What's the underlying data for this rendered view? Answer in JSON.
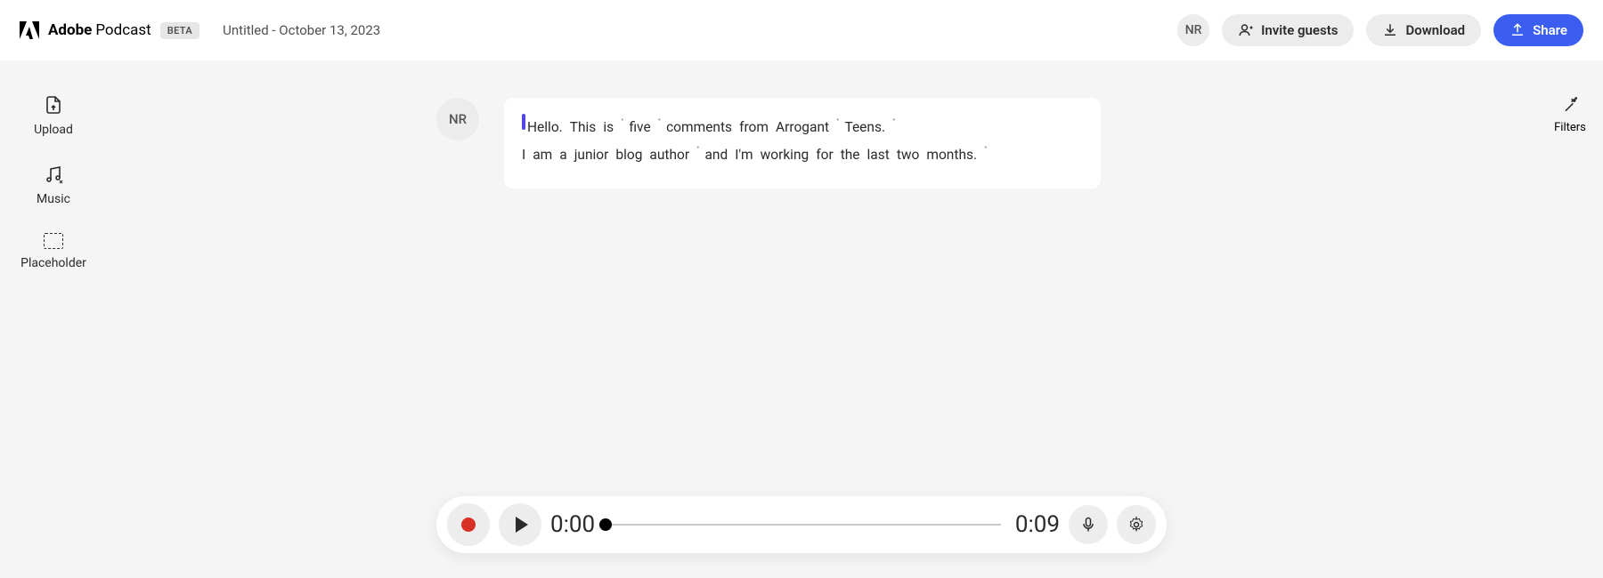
{
  "header": {
    "brand": "Adobe",
    "product": "Podcast",
    "beta": "BETA",
    "title": "Untitled - October 13, 2023",
    "avatar_initials": "NR",
    "invite_label": "Invite guests",
    "download_label": "Download",
    "share_label": "Share"
  },
  "sidebar": {
    "items": [
      {
        "label": "Upload"
      },
      {
        "label": "Music"
      },
      {
        "label": "Placeholder"
      }
    ]
  },
  "right_panel": {
    "filters_label": "Filters"
  },
  "transcript": {
    "speaker_initials": "NR",
    "line1_words": [
      "Hello.",
      "This",
      "is",
      "•",
      "five",
      "•",
      "comments",
      "from",
      "Arrogant",
      "•",
      "Teens.",
      "•"
    ],
    "line2_words": [
      "I",
      "am",
      "a",
      "junior",
      "blog",
      "author",
      "•",
      "and",
      "I'm",
      "working",
      "for",
      "the",
      "last",
      "two",
      "months.",
      "•"
    ]
  },
  "player": {
    "current_time": "0:00",
    "total_time": "0:09"
  }
}
